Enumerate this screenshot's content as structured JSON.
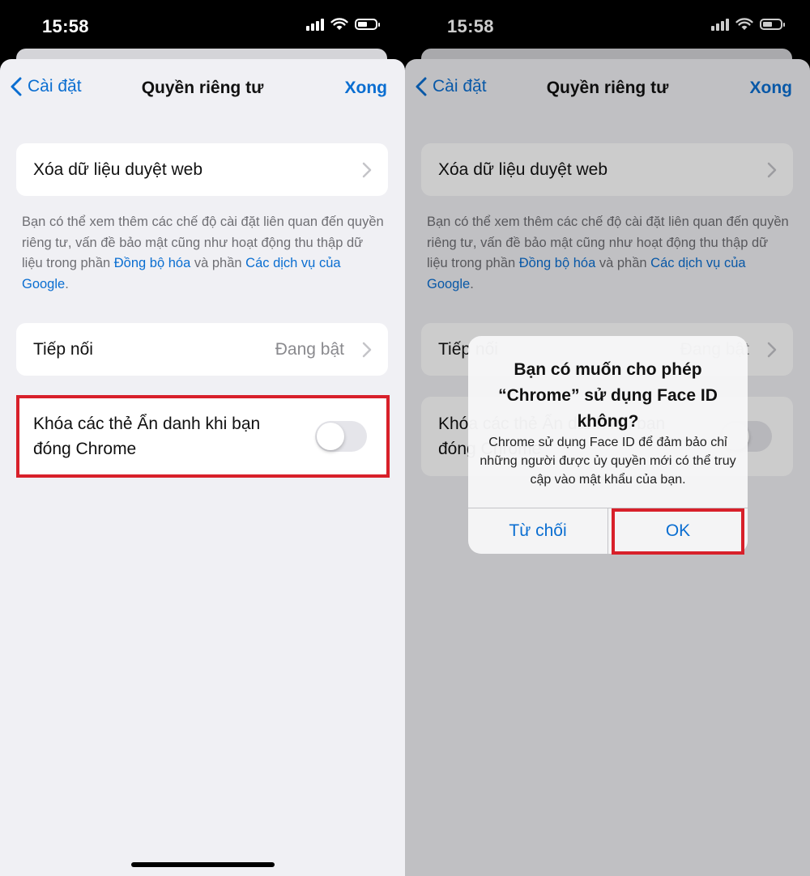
{
  "status": {
    "time": "15:58"
  },
  "nav": {
    "back_label": "Cài đặt",
    "title": "Quyền riêng tư",
    "done_label": "Xong"
  },
  "rows": {
    "clear_data": {
      "label": "Xóa dữ liệu duyệt web"
    },
    "handoff": {
      "label": "Tiếp nối",
      "value": "Đang bật"
    },
    "lock_incognito": {
      "label": "Khóa các thẻ Ẩn danh khi bạn đóng Chrome",
      "enabled": false
    }
  },
  "description": {
    "text_1": "Bạn có thể xem thêm các chế độ cài đặt liên quan đến quyền riêng tư, vấn đề bảo mật cũng như hoạt động thu thập dữ liệu trong phần ",
    "link_1": "Đồng bộ hóa",
    "text_2": " và phần ",
    "link_2": "Các dịch vụ của Google",
    "text_3": "."
  },
  "alert": {
    "title": "Bạn có muốn cho phép “Chrome” sử dụng Face ID không?",
    "message": "Chrome sử dụng Face ID để đảm bảo chỉ những người được ủy quyền mới có thể truy cập vào mật khẩu của bạn.",
    "deny_label": "Từ chối",
    "ok_label": "OK"
  },
  "colors": {
    "accent": "#0a6ed1",
    "highlight": "#d8202a",
    "toggle_off": "#e5e5ea"
  },
  "icons": [
    "chevron-left-icon",
    "chevron-right-icon",
    "signal-icon",
    "wifi-icon",
    "battery-icon"
  ]
}
